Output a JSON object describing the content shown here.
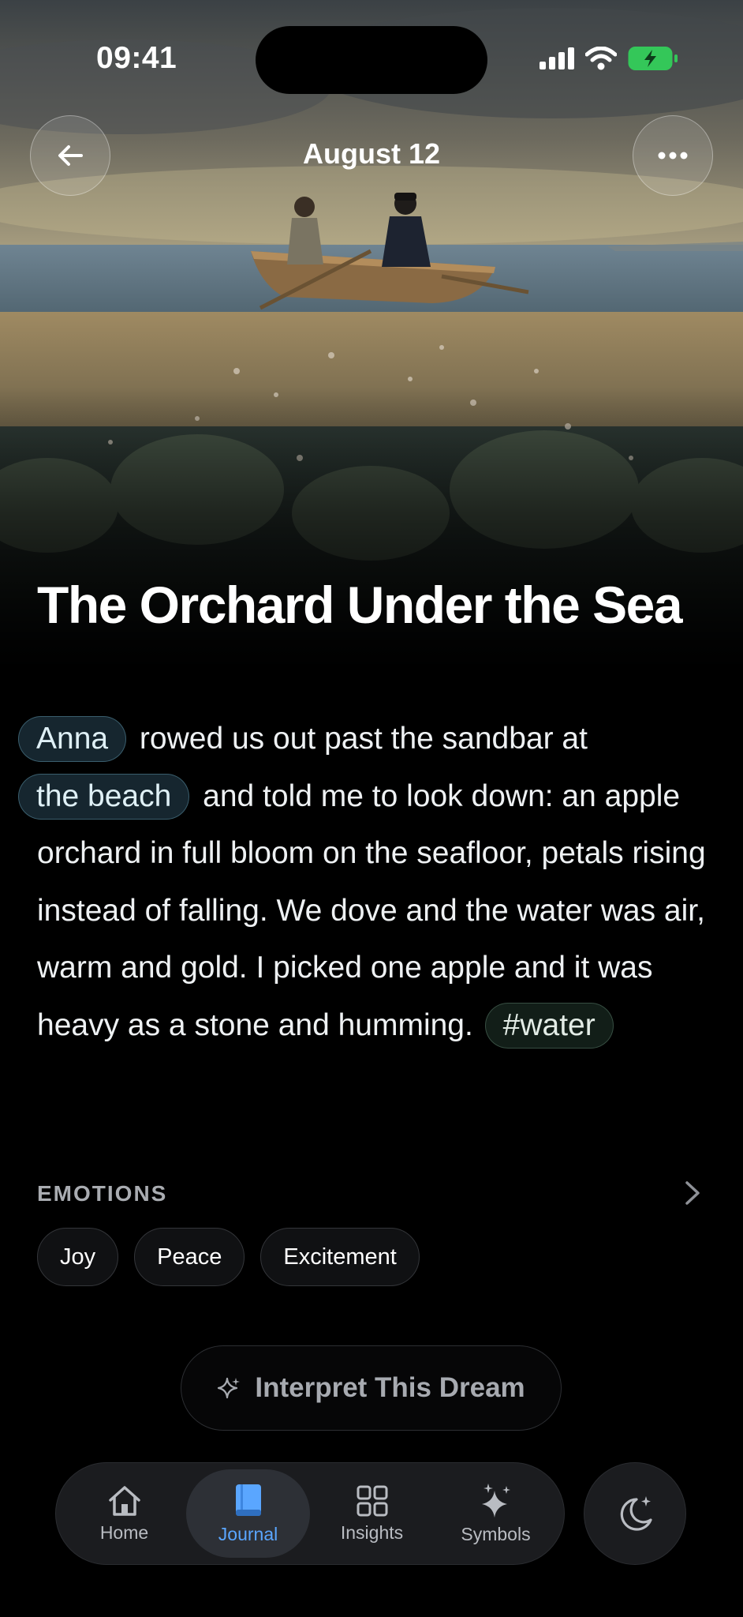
{
  "status_bar": {
    "time": "09:41"
  },
  "header": {
    "date": "August 12"
  },
  "dream": {
    "title": "The Orchard Under the Sea",
    "person_chip": "Anna",
    "text_1": " rowed us out past the sandbar at",
    "place_chip": "the beach",
    "text_2": " and told me to look down: an apple orchard in full bloom on the seafloor, petals rising instead of falling. We dove and the water was air, warm and gold. I picked one apple and it was heavy as a stone and humming. ",
    "tag_chip": "#water"
  },
  "emotions": {
    "label": "EMOTIONS",
    "items": [
      "Joy",
      "Peace",
      "Excitement"
    ]
  },
  "interpret": {
    "label": "Interpret This Dream",
    "icon": "sparkle-icon"
  },
  "tabbar": {
    "tabs": [
      {
        "label": "Home",
        "icon": "home-icon"
      },
      {
        "label": "Journal",
        "icon": "book-icon",
        "active": true
      },
      {
        "label": "Insights",
        "icon": "grid-icon"
      },
      {
        "label": "Symbols",
        "icon": "sparkles-icon"
      }
    ],
    "moon_icon": "moon-icon"
  },
  "colors": {
    "accent": "#5aa6ff",
    "battery": "#34c759",
    "background": "#000000"
  }
}
